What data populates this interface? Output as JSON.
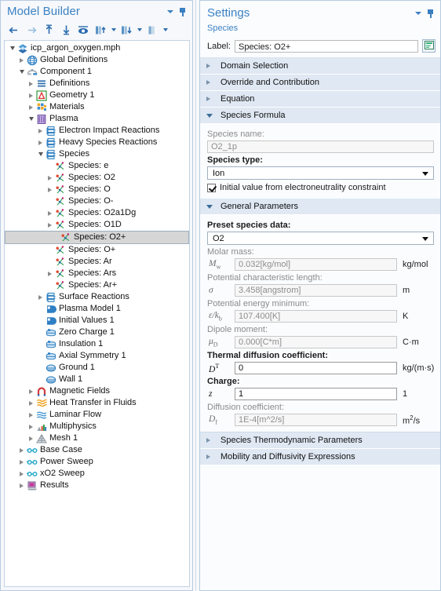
{
  "model_builder": {
    "title": "Model Builder",
    "header_buttons": [
      {
        "name": "collapse-menu",
        "icon": "chevron-down-icon"
      },
      {
        "name": "pin",
        "icon": "pin-icon"
      }
    ],
    "toolbar": [
      {
        "name": "back-button",
        "icon": "arrow-left-icon"
      },
      {
        "name": "forward-button",
        "icon": "arrow-right-icon"
      },
      {
        "name": "move-up-button",
        "icon": "arrow-up-icon"
      },
      {
        "name": "move-down-button",
        "icon": "arrow-down-icon"
      },
      {
        "name": "show-hide-button",
        "icon": "eye-icon"
      },
      {
        "name": "collapse-all-button",
        "icon": "collapse-tree-icon",
        "has_caret": true
      },
      {
        "name": "expand-all-button",
        "icon": "expand-tree-icon",
        "has_caret": true
      },
      {
        "name": "model-tree-filter-button",
        "icon": "columns-icon",
        "has_caret": true
      }
    ],
    "tree": [
      {
        "depth": 0,
        "arrow": "open",
        "icon": "mph-file-icon",
        "label": "icp_argon_oxygen.mph"
      },
      {
        "depth": 1,
        "arrow": "closed",
        "icon": "globe-icon",
        "label": "Global Definitions"
      },
      {
        "depth": 1,
        "arrow": "open",
        "icon": "component-icon",
        "label": "Component 1"
      },
      {
        "depth": 2,
        "arrow": "closed",
        "icon": "definitions-icon",
        "label": "Definitions"
      },
      {
        "depth": 2,
        "arrow": "closed",
        "icon": "geometry-icon",
        "label": "Geometry 1"
      },
      {
        "depth": 2,
        "arrow": "closed",
        "icon": "materials-icon",
        "label": "Materials"
      },
      {
        "depth": 2,
        "arrow": "open",
        "icon": "plasma-icon",
        "label": "Plasma"
      },
      {
        "depth": 3,
        "arrow": "closed",
        "icon": "reaction-icon",
        "label": "Electron Impact Reactions"
      },
      {
        "depth": 3,
        "arrow": "closed",
        "icon": "reaction-icon",
        "label": "Heavy Species Reactions"
      },
      {
        "depth": 3,
        "arrow": "open",
        "icon": "reaction-icon",
        "label": "Species"
      },
      {
        "depth": 4,
        "arrow": "none",
        "icon": "species-icon",
        "label": "Species: e"
      },
      {
        "depth": 4,
        "arrow": "closed",
        "icon": "species-icon",
        "label": "Species: O2"
      },
      {
        "depth": 4,
        "arrow": "closed",
        "icon": "species-icon",
        "label": "Species: O"
      },
      {
        "depth": 4,
        "arrow": "none",
        "icon": "species-icon",
        "label": "Species: O-"
      },
      {
        "depth": 4,
        "arrow": "closed",
        "icon": "species-icon",
        "label": "Species: O2a1Dg"
      },
      {
        "depth": 4,
        "arrow": "closed",
        "icon": "species-icon",
        "label": "Species: O1D"
      },
      {
        "depth": 4,
        "arrow": "none",
        "icon": "species-icon",
        "label": "Species: O2+",
        "selected": true
      },
      {
        "depth": 4,
        "arrow": "none",
        "icon": "species-icon",
        "label": "Species: O+"
      },
      {
        "depth": 4,
        "arrow": "none",
        "icon": "species-icon",
        "label": "Species: Ar"
      },
      {
        "depth": 4,
        "arrow": "closed",
        "icon": "species-icon",
        "label": "Species: Ars"
      },
      {
        "depth": 4,
        "arrow": "none",
        "icon": "species-icon",
        "label": "Species: Ar+"
      },
      {
        "depth": 3,
        "arrow": "closed",
        "icon": "reaction-icon",
        "label": "Surface Reactions"
      },
      {
        "depth": 3,
        "arrow": "none",
        "icon": "model-node-icon",
        "label": "Plasma Model 1"
      },
      {
        "depth": 3,
        "arrow": "none",
        "icon": "model-node-icon",
        "label": "Initial Values 1"
      },
      {
        "depth": 3,
        "arrow": "none",
        "icon": "boundary-node-icon",
        "label": "Zero Charge 1"
      },
      {
        "depth": 3,
        "arrow": "none",
        "icon": "boundary-node-icon",
        "label": "Insulation 1"
      },
      {
        "depth": 3,
        "arrow": "none",
        "icon": "boundary-node-icon",
        "label": "Axial Symmetry 1"
      },
      {
        "depth": 3,
        "arrow": "none",
        "icon": "ground-node-icon",
        "label": "Ground 1"
      },
      {
        "depth": 3,
        "arrow": "none",
        "icon": "ground-node-icon",
        "label": "Wall 1"
      },
      {
        "depth": 2,
        "arrow": "closed",
        "icon": "magnetic-fields-icon",
        "label": "Magnetic Fields"
      },
      {
        "depth": 2,
        "arrow": "closed",
        "icon": "heat-transfer-icon",
        "label": "Heat Transfer in Fluids"
      },
      {
        "depth": 2,
        "arrow": "closed",
        "icon": "laminar-flow-icon",
        "label": "Laminar Flow"
      },
      {
        "depth": 2,
        "arrow": "closed",
        "icon": "multiphysics-icon",
        "label": "Multiphysics"
      },
      {
        "depth": 2,
        "arrow": "closed",
        "icon": "mesh-icon",
        "label": "Mesh 1"
      },
      {
        "depth": 1,
        "arrow": "closed",
        "icon": "study-icon",
        "label": "Base Case"
      },
      {
        "depth": 1,
        "arrow": "closed",
        "icon": "study-icon",
        "label": "Power Sweep"
      },
      {
        "depth": 1,
        "arrow": "closed",
        "icon": "study-icon",
        "label": "xO2 Sweep"
      },
      {
        "depth": 1,
        "arrow": "closed",
        "icon": "results-icon",
        "label": "Results"
      }
    ]
  },
  "settings": {
    "title": "Settings",
    "subtitle": "Species",
    "header_buttons": [
      {
        "name": "collapse-menu",
        "icon": "chevron-down-icon"
      },
      {
        "name": "pin",
        "icon": "pin-icon"
      }
    ],
    "label_field": {
      "caption": "Label:",
      "value": "Species: O2+",
      "button_name": "rename-button",
      "button_icon": "note-icon"
    },
    "collapsed_sections": [
      {
        "title": "Domain Selection"
      },
      {
        "title": "Override and Contribution"
      },
      {
        "title": "Equation"
      }
    ],
    "species_formula": {
      "title": "Species Formula",
      "species_name_caption": "Species name:",
      "species_name_value": "O2_1p",
      "species_type_caption": "Species type:",
      "species_type_value": "Ion",
      "checkbox_label": "Initial value from electroneutrality constraint",
      "checkbox_checked": true
    },
    "general_parameters": {
      "title": "General Parameters",
      "preset_caption": "Preset species data:",
      "preset_value": "O2",
      "fields": [
        {
          "caption": "Molar mass:",
          "symbol": "Mw",
          "value": "0.032[kg/mol]",
          "unit": "kg/mol",
          "enabled": false
        },
        {
          "caption": "Potential characteristic length:",
          "symbol": "sigma",
          "value": "3.458[angstrom]",
          "unit": "m",
          "enabled": false
        },
        {
          "caption": "Potential energy minimum:",
          "symbol": "epsilon_kb",
          "value": "107.400[K]",
          "unit": "K",
          "enabled": false
        },
        {
          "caption": "Dipole moment:",
          "symbol": "muD",
          "value": "0.000[C*m]",
          "unit": "C·m",
          "enabled": false
        },
        {
          "caption": "Thermal diffusion coefficient:",
          "symbol": "DT",
          "value": "0",
          "unit": "kg/(m·s)",
          "enabled": true
        },
        {
          "caption": "Charge:",
          "symbol": "z",
          "value": "1",
          "unit": "1",
          "enabled": true
        },
        {
          "caption": "Diffusion coefficient:",
          "symbol": "Df",
          "value": "1E-4[m^2/s]",
          "unit": "m2/s",
          "enabled": false
        }
      ]
    },
    "trailing_sections": [
      {
        "title": "Species Thermodynamic Parameters"
      },
      {
        "title": "Mobility and Diffusivity Expressions"
      }
    ]
  },
  "colors": {
    "accent": "#3b82c4",
    "section_header": "#dfe8f3",
    "panel_bg": "#fbfcfe",
    "selection": "#d6d6d6"
  }
}
